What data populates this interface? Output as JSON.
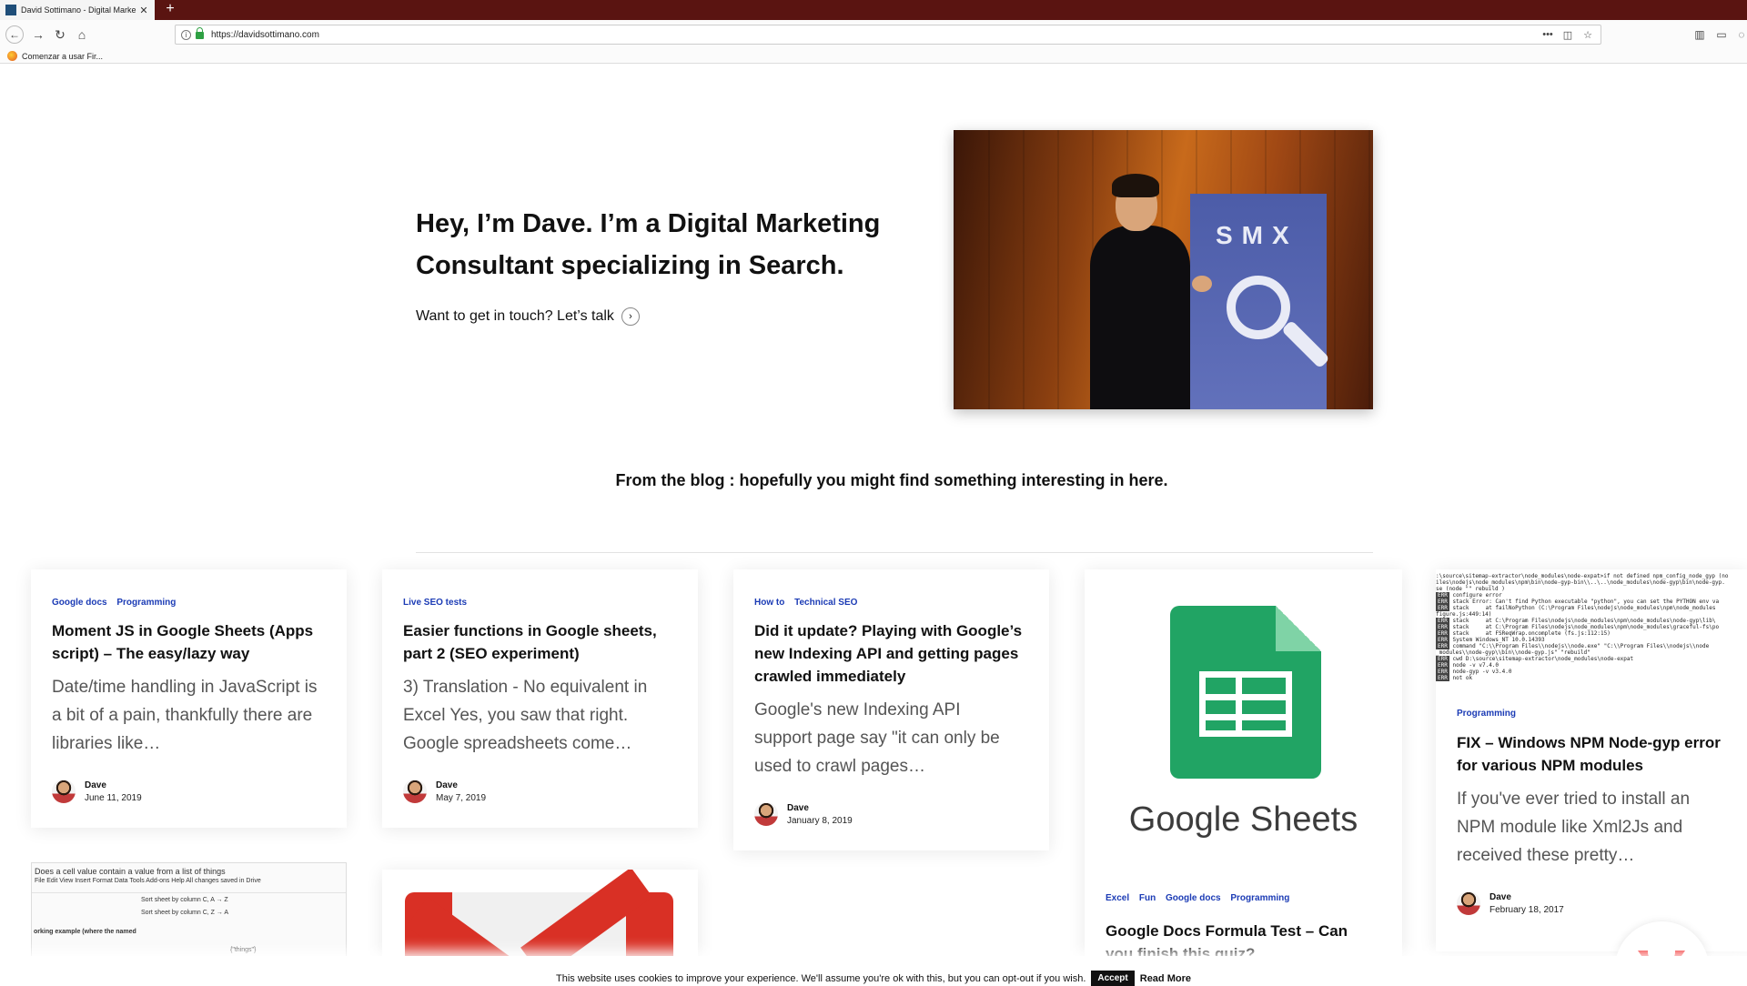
{
  "browser": {
    "tab_title": "David Sottimano - Digital Marke",
    "tab_close": "✕",
    "new_tab": "+",
    "url": "https://davidsottimano.com",
    "bookmark": "Comenzar a usar Fir..."
  },
  "hero": {
    "title": "Hey, I’m Dave. I’m a Digital Marketing Consultant specializing in Search.",
    "cta": "Want to get in touch? Let’s talk",
    "photo_banner": "SMX"
  },
  "blog": {
    "heading": "From the blog : hopefully you might find something interesting in here."
  },
  "cards": [
    {
      "tags": [
        "Google docs",
        "Programming"
      ],
      "title": "Moment JS in Google Sheets (Apps script) – The easy/lazy way",
      "excerpt": "Date/time handling in JavaScript is a bit of a pain, thankfully there are libraries like…",
      "author": "Dave",
      "date": "June 11, 2019"
    },
    {
      "tags": [
        "Live SEO tests"
      ],
      "title": "Easier functions in Google sheets, part 2 (SEO experiment)",
      "excerpt": "3) Translation - No equivalent in Excel Yes, you saw that right. Google spreadsheets come…",
      "author": "Dave",
      "date": "May 7, 2019"
    },
    {
      "tags": [
        "How to",
        "Technical SEO"
      ],
      "title": "Did it update? Playing with Google’s new Indexing API and getting pages crawled immediately",
      "excerpt": "Google's new Indexing API support page say \"it can only be used to crawl pages…",
      "author": "Dave",
      "date": "January 8, 2019"
    },
    {
      "image_word": "Google Sheets",
      "tags": [
        "Excel",
        "Fun",
        "Google docs",
        "Programming"
      ],
      "title": "Google Docs Formula Test – Can you finish this quiz?"
    },
    {
      "tags": [
        "Programming"
      ],
      "title": "FIX – Windows NPM Node-gyp error for various NPM modules",
      "excerpt": "If you've ever tried to install an NPM module like Xml2Js and received these pretty…",
      "author": "Dave",
      "date": "February 18, 2017"
    }
  ],
  "sheet_thumb": {
    "title": "Does a cell value contain a value from a list of things",
    "menu": "File   Edit   View   Insert   Format   Data   Tools   Add-ons   Help     All changes saved in Drive",
    "row_label": "orking example (where the named",
    "sort_a": "Sort sheet by column C, A → Z",
    "sort_b": "Sort sheet by column C, Z → A",
    "cell": "{\"things\"}"
  },
  "cookie": {
    "text": "This website uses cookies to improve your experience. We'll assume you're ok with this, but you can opt-out if you wish.",
    "accept": "Accept",
    "read_more": "Read More"
  },
  "colors": {
    "tabbar": "#5a1411",
    "tag_blue": "#1b3bb5",
    "sheets_green": "#21a464",
    "gmail_red": "#d93025",
    "fab_red": "#ee0000"
  }
}
